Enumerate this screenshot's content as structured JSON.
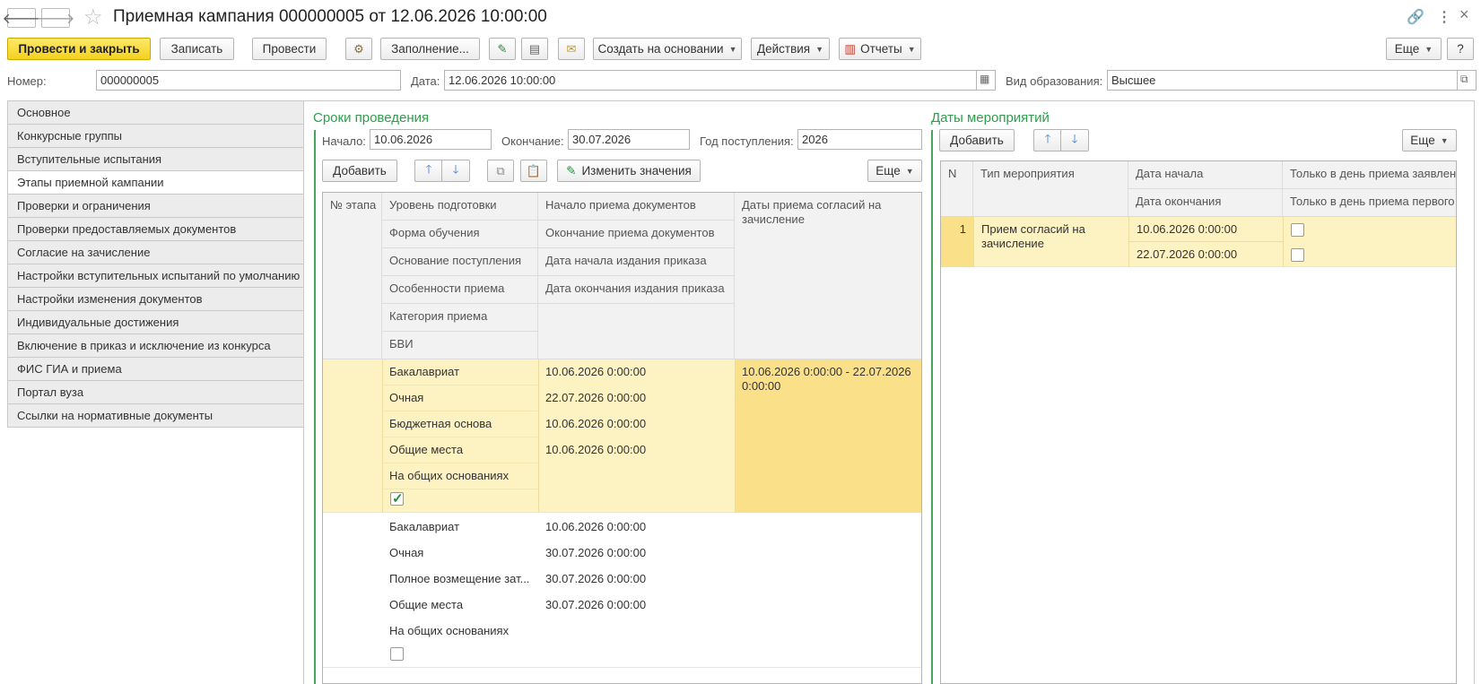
{
  "window": {
    "title": "Приемная кампания 000000005 от 12.06.2026 10:00:00"
  },
  "toolbar": {
    "post_close": "Провести и закрыть",
    "save": "Записать",
    "post": "Провести",
    "fill": "Заполнение...",
    "create_based": "Создать на основании",
    "actions": "Действия",
    "reports": "Отчеты",
    "more": "Еще",
    "help": "?"
  },
  "header": {
    "number_label": "Номер:",
    "number_value": "000000005",
    "date_label": "Дата:",
    "date_value": "12.06.2026 10:00:00",
    "edu_label": "Вид образования:",
    "edu_value": "Высшее"
  },
  "sidebar": {
    "items": [
      {
        "label": "Основное",
        "active": false
      },
      {
        "label": "Конкурсные группы",
        "active": false
      },
      {
        "label": "Вступительные испытания",
        "active": false
      },
      {
        "label": "Этапы приемной кампании",
        "active": true
      },
      {
        "label": "Проверки и ограничения",
        "active": false
      },
      {
        "label": "Проверки предоставляемых документов",
        "active": false
      },
      {
        "label": "Согласие на зачисление",
        "active": false
      },
      {
        "label": "Настройки вступительных испытаний по умолчанию",
        "active": false
      },
      {
        "label": "Настройки изменения документов",
        "active": false
      },
      {
        "label": "Индивидуальные достижения",
        "active": false
      },
      {
        "label": "Включение в приказ и исключение из конкурса",
        "active": false
      },
      {
        "label": "ФИС ГИА и приема",
        "active": false
      },
      {
        "label": "Портал вуза",
        "active": false
      },
      {
        "label": "Ссылки на нормативные документы",
        "active": false
      }
    ]
  },
  "stages": {
    "section_title": "Сроки проведения",
    "start_label": "Начало:",
    "start_value": "10.06.2026",
    "end_label": "Окончание:",
    "end_value": "30.07.2026",
    "year_label": "Год поступления:",
    "year_value": "2026",
    "add": "Добавить",
    "change_values": "Изменить значения",
    "more": "Еще",
    "columns": {
      "stage_no": "№ этапа",
      "col2": [
        "Уровень подготовки",
        "Форма обучения",
        "Основание поступления",
        "Особенности приема",
        "Категория приема",
        "БВИ"
      ],
      "col3": [
        "Начало приема документов",
        "Окончание приема документов",
        "Дата начала издания приказа",
        "Дата окончания издания приказа"
      ],
      "col4": "Даты приема согласий на зачисление"
    },
    "rows": [
      {
        "col2": [
          "Бакалавриат",
          "Очная",
          "Бюджетная основа",
          "Общие места",
          "На общих основаниях"
        ],
        "bvi": true,
        "col3": [
          "10.06.2026 0:00:00",
          "22.07.2026 0:00:00",
          "10.06.2026 0:00:00",
          "10.06.2026 0:00:00"
        ],
        "col4": "10.06.2026 0:00:00 - 22.07.2026 0:00:00"
      },
      {
        "col2": [
          "Бакалавриат",
          "Очная",
          "Полное возмещение зат...",
          "Общие места",
          "На общих основаниях"
        ],
        "bvi": false,
        "col3": [
          "10.06.2026 0:00:00",
          "30.07.2026 0:00:00",
          "30.07.2026 0:00:00",
          "30.07.2026 0:00:00"
        ],
        "col4": ""
      }
    ]
  },
  "events": {
    "section_title": "Даты мероприятий",
    "add": "Добавить",
    "more": "Еще",
    "columns": {
      "n": "N",
      "type": "Тип мероприятия",
      "start": "Дата начала",
      "end": "Дата окончания",
      "only_day_app": "Только в день приема заявлен",
      "only_day_first": "Только в день приема первого"
    },
    "rows": [
      {
        "n": "1",
        "type": "Прием согласий на зачисление",
        "start": "10.06.2026 0:00:00",
        "end": "22.07.2026 0:00:00"
      }
    ]
  },
  "colors": {
    "accent_green": "#2d9e4a",
    "selected_row": "#fdf2c2",
    "selected_cell": "#fbe08a",
    "primary_button": "#f4d21e"
  }
}
